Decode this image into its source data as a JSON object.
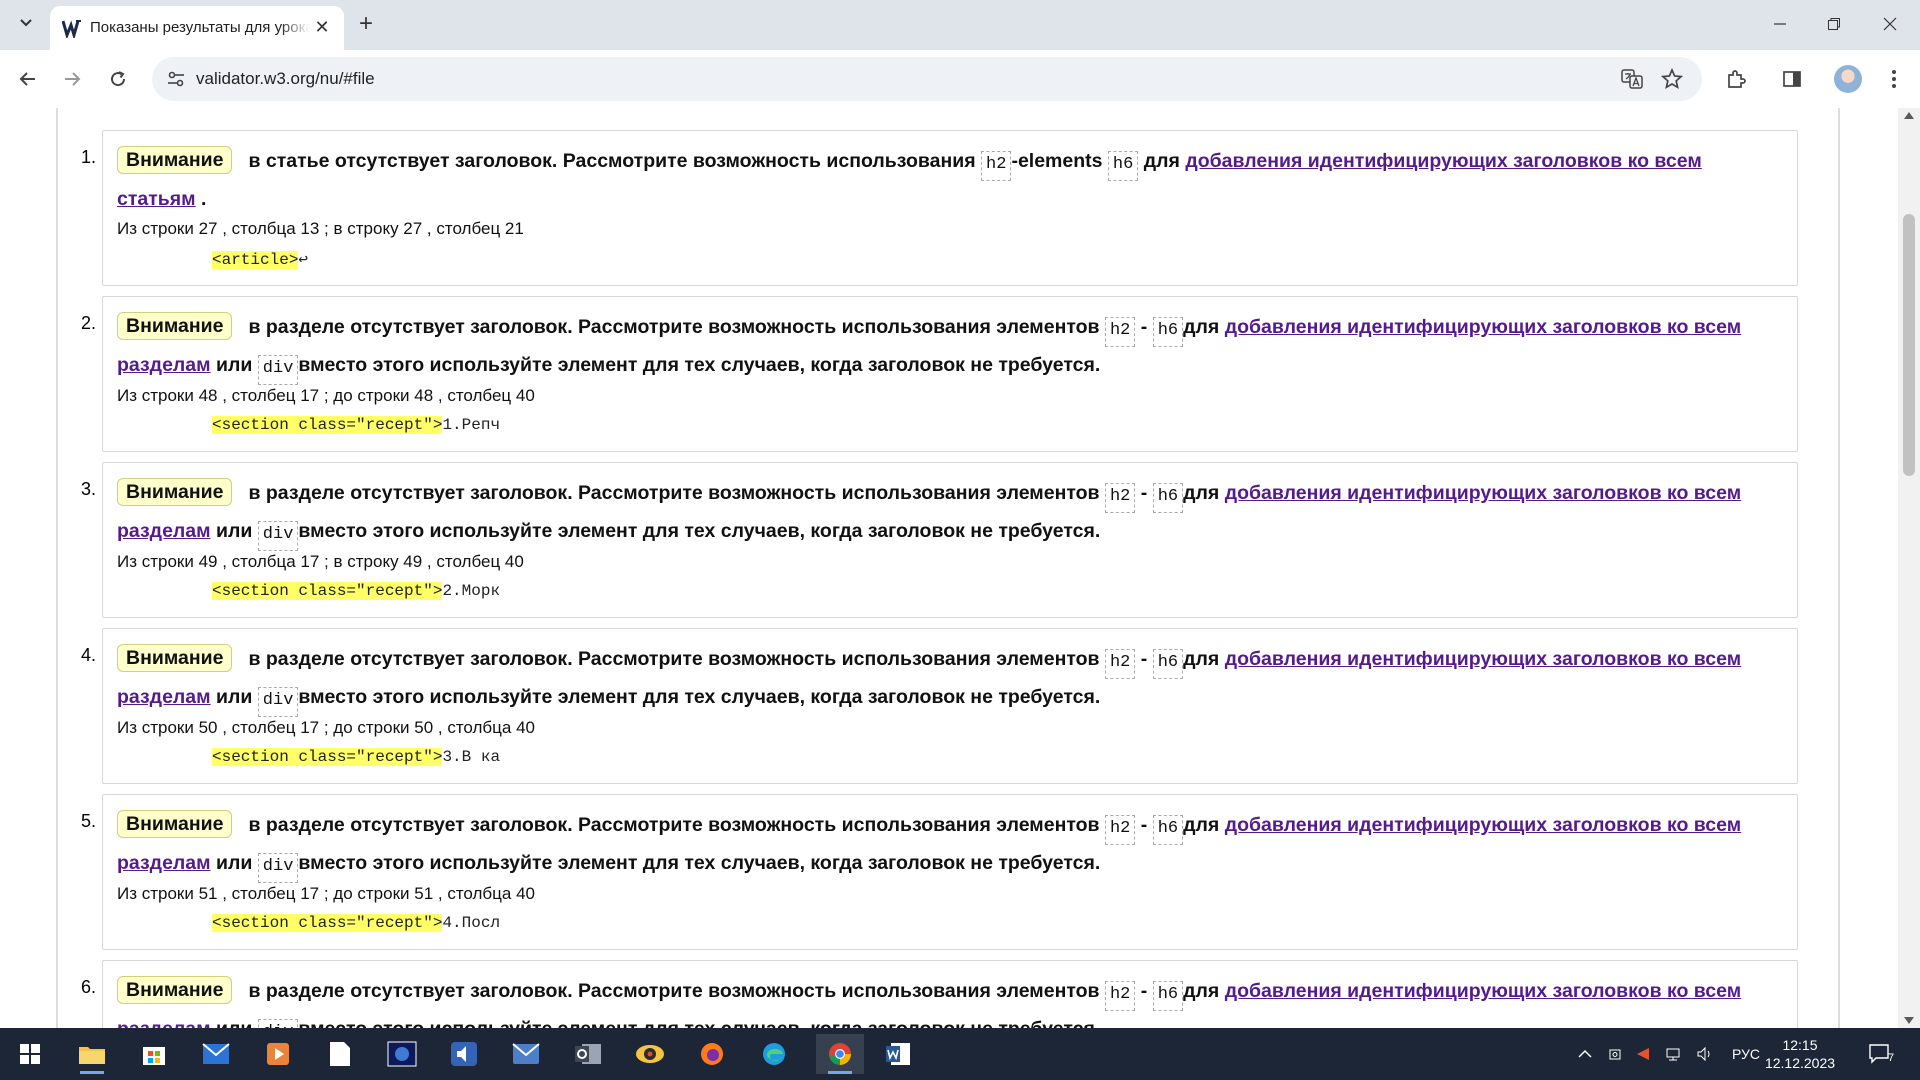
{
  "browser": {
    "tab_title": "Показаны результаты для урока",
    "url": "validator.w3.org/nu/#file"
  },
  "messages": [
    {
      "num": "1.",
      "badge": "Внимание",
      "text_a": "в статье отсутствует заголовок. Рассмотрите возможность использования",
      "code1": "h2",
      "sep": "-elements",
      "code2": "h6",
      "word_for": "для",
      "link1": "добавления идентифицирующих заголовков ко всем статьям",
      "tail": " .",
      "location": "Из строки 27 , столбца 13 ; в строку 27 , столбец 21",
      "extract_mark": "<article>",
      "extract_rest": "↩"
    },
    {
      "num": "2.",
      "badge": "Внимание",
      "text_a": "в разделе отсутствует заголовок. Рассмотрите возможность использования элементов",
      "code1": "h2",
      "sep": "-",
      "code2": "h6",
      "word_for": "для",
      "link1": "добавления идентифицирующих заголовков ко всем разделам",
      "word_or": "или",
      "code3": "div",
      "text_b": "вместо этого используйте элемент для тех случаев, когда заголовок не требуется.",
      "location": "Из строки 48 , столбец 17 ; до строки 48 , столбец 40",
      "extract_mark": "<section class=\"recept\">",
      "extract_rest": "1.Репч"
    },
    {
      "num": "3.",
      "badge": "Внимание",
      "text_a": "в разделе отсутствует заголовок. Рассмотрите возможность использования элементов",
      "code1": "h2",
      "sep": "-",
      "code2": "h6",
      "word_for": "для",
      "link1": "добавления идентифицирующих заголовков ко всем разделам",
      "word_or": "или",
      "code3": "div",
      "text_b": "вместо этого используйте элемент для тех случаев, когда заголовок не требуется.",
      "location": "Из строки 49 , столбца 17 ; в строку 49 , столбец 40",
      "extract_mark": "<section class=\"recept\">",
      "extract_rest": "2.Морк"
    },
    {
      "num": "4.",
      "badge": "Внимание",
      "text_a": "в разделе отсутствует заголовок. Рассмотрите возможность использования элементов",
      "code1": "h2",
      "sep": "-",
      "code2": "h6",
      "word_for": "для",
      "link1": "добавления идентифицирующих заголовков ко всем разделам",
      "word_or": "или",
      "code3": "div",
      "text_b": "вместо этого используйте элемент для тех случаев, когда заголовок не требуется.",
      "location": "Из строки 50 , столбец 17 ; до строки 50 , столбца 40",
      "extract_mark": "<section class=\"recept\">",
      "extract_rest": "3.В ка"
    },
    {
      "num": "5.",
      "badge": "Внимание",
      "text_a": "в разделе отсутствует заголовок. Рассмотрите возможность использования элементов",
      "code1": "h2",
      "sep": "-",
      "code2": "h6",
      "word_for": "для",
      "link1": "добавления идентифицирующих заголовков ко всем разделам",
      "word_or": "или",
      "code3": "div",
      "text_b": "вместо этого используйте элемент для тех случаев, когда заголовок не требуется.",
      "location": "Из строки 51 , столбец 17 ; до строки 51 , столбца 40",
      "extract_mark": "<section class=\"recept\">",
      "extract_rest": "4.Посл"
    },
    {
      "num": "6.",
      "badge": "Внимание",
      "text_a": "в разделе отсутствует заголовок. Рассмотрите возможность использования элементов",
      "code1": "h2",
      "sep": "-",
      "code2": "h6",
      "word_for": "для",
      "link1": "добавления идентифицирующих заголовков ко всем разделам",
      "word_or": "или",
      "code3": "div",
      "text_b": "вместо этого используйте элемент для тех случаев, когда заголовок не требуется."
    }
  ],
  "taskbar": {
    "lang": "РУС",
    "time": "12:15",
    "date": "12.12.2023",
    "notifications": "7"
  }
}
